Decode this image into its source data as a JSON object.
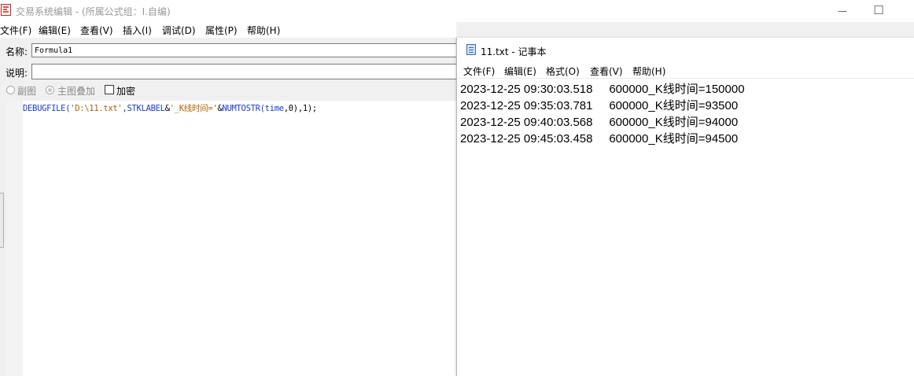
{
  "editor": {
    "title": "交易系统编辑 - (所属公式组：I.自编)",
    "window_controls": {
      "minimize": "—",
      "maximize": "☐"
    },
    "menu": [
      "文件(F)",
      "编辑(E)",
      "查看(V)",
      "插入(I)",
      "调试(D)",
      "属性(P)",
      "帮助(H)"
    ],
    "name_label": "名称:",
    "name_value": "Formula1",
    "desc_label": "说明:",
    "desc_value": "",
    "options": {
      "subchart": "副图",
      "main_overlay": "主图叠加",
      "encrypt": "加密"
    },
    "code": {
      "p1": "DEBUGFILE(",
      "p2": "'D:\\11.txt'",
      "p3": ",",
      "p4": "STKLABEL",
      "p5": "&",
      "p6": "'_K线时间='",
      "p7": "&",
      "p8": "NUMTOSTR(",
      "p9": "time",
      "p10": ",0),1);"
    }
  },
  "notepad": {
    "title": "11.txt - 记事本",
    "menu": [
      "文件(F)",
      "编辑(E)",
      "格式(O)",
      "查看(V)",
      "帮助(H)"
    ],
    "lines": [
      "2023-12-25 09:30:03.518     600000_K线时间=150000",
      "2023-12-25 09:35:03.781     600000_K线时间=93500",
      "2023-12-25 09:40:03.568     600000_K线时间=94000",
      "2023-12-25 09:45:03.458     600000_K线时间=94500"
    ]
  },
  "colors": {
    "keyword": "#1a3ad0",
    "string": "#b06400",
    "icon_red": "#cc1f1f"
  }
}
